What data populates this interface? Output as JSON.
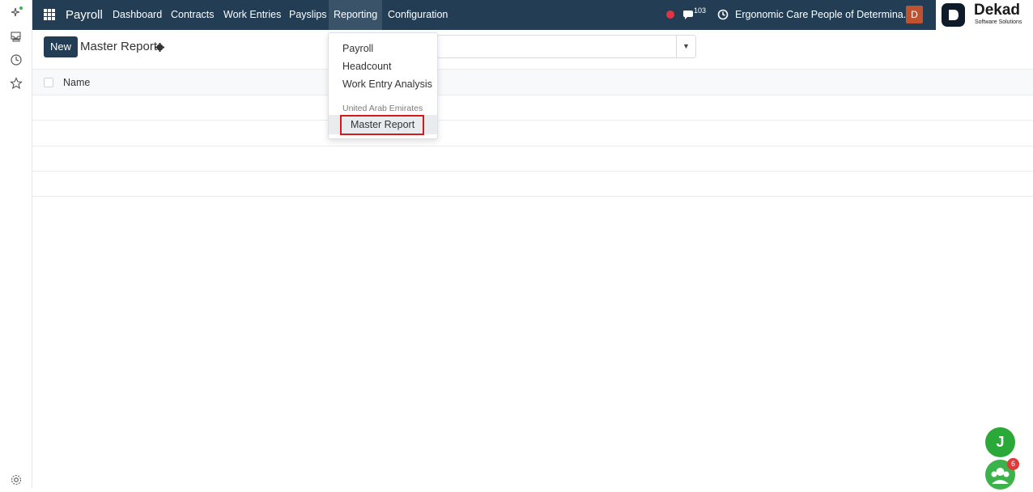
{
  "topbar": {
    "app_name": "Payroll",
    "menu": [
      "Dashboard",
      "Contracts",
      "Work Entries",
      "Payslips",
      "Reporting",
      "Configuration"
    ],
    "message_count": "103",
    "company": "Ergonomic Care People of Determina...",
    "user_initial": "D",
    "brand_name": "Dekad",
    "brand_tagline": "Software Solutions",
    "bg_color": "#233e54"
  },
  "control": {
    "new_label": "New",
    "breadcrumb": "Master Report"
  },
  "list": {
    "column_name": "Name"
  },
  "reporting_menu": {
    "items": [
      "Payroll",
      "Headcount",
      "Work Entry Analysis"
    ],
    "section": "United Arab Emirates",
    "section_items": [
      "Master Report"
    ]
  },
  "floating": {
    "avatar_initial": "J",
    "chat_badge": "6"
  }
}
